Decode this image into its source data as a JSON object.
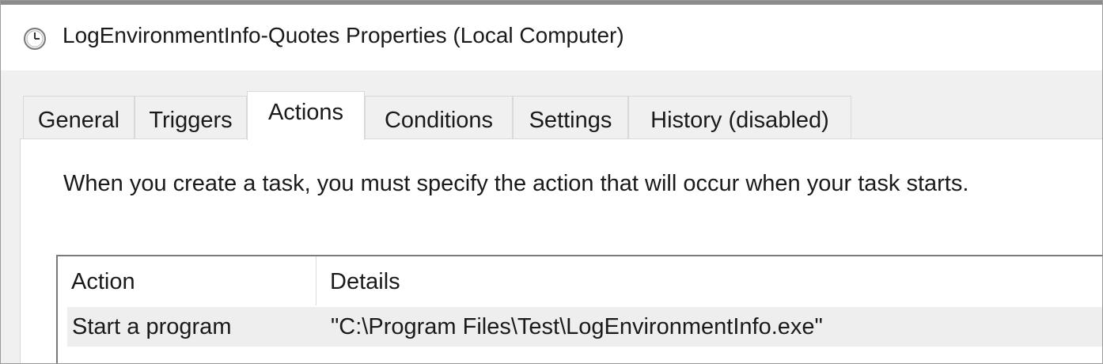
{
  "window": {
    "title": "LogEnvironmentInfo-Quotes Properties (Local Computer)",
    "icon": "clock-icon"
  },
  "tabs": [
    {
      "label": "General",
      "active": false
    },
    {
      "label": "Triggers",
      "active": false
    },
    {
      "label": "Actions",
      "active": true
    },
    {
      "label": "Conditions",
      "active": false
    },
    {
      "label": "Settings",
      "active": false
    },
    {
      "label": "History (disabled)",
      "active": false
    }
  ],
  "actions_panel": {
    "description": "When you create a task, you must specify the action that will occur when your task starts.",
    "columns": [
      "Action",
      "Details"
    ],
    "rows": [
      {
        "action": "Start a program",
        "details": "\"C:\\Program Files\\Test\\LogEnvironmentInfo.exe\""
      }
    ]
  }
}
